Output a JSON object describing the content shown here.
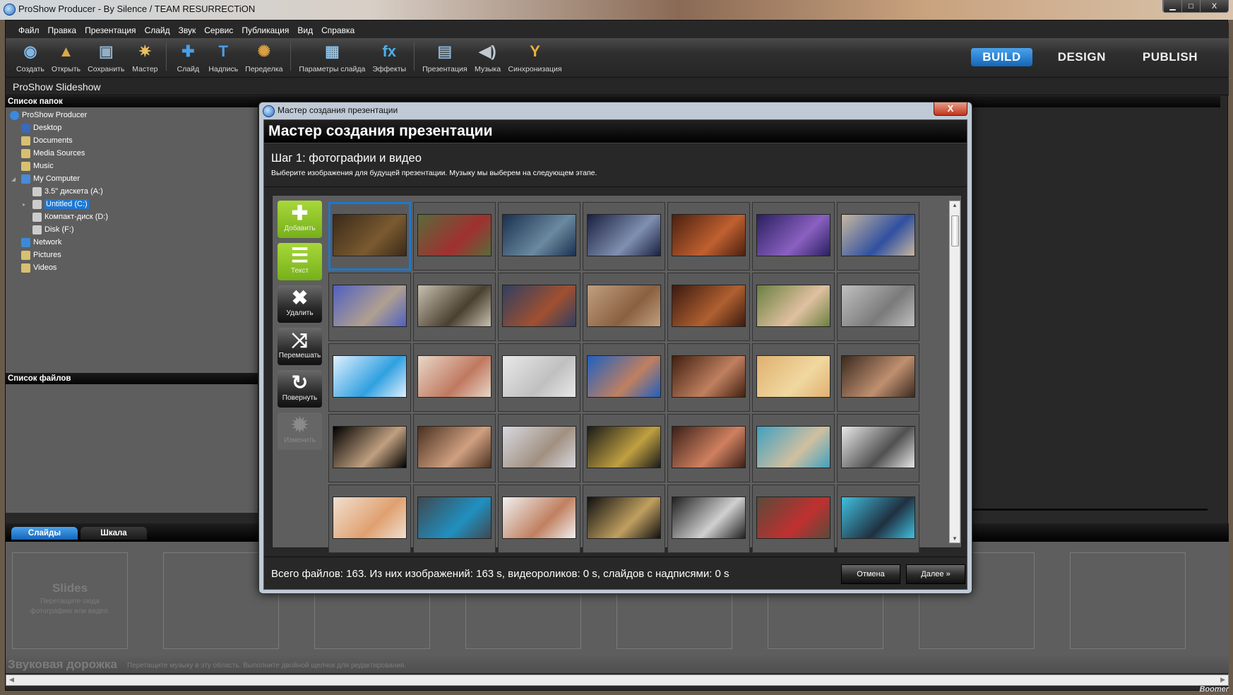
{
  "window": {
    "title": "ProShow Producer -  By Silence / TEAM RESURRECTiON",
    "controls": [
      "▁",
      "□",
      "X"
    ]
  },
  "menu": [
    "Файл",
    "Правка",
    "Презентация",
    "Слайд",
    "Звук",
    "Сервис",
    "Публикация",
    "Вид",
    "Справка"
  ],
  "toolbar": [
    {
      "label": "Создать",
      "icon": "film-reel-icon",
      "glyph": "◉",
      "color": "#7fb6e8"
    },
    {
      "label": "Открыть",
      "icon": "open-folder-icon",
      "glyph": "▲",
      "color": "#d8a84a"
    },
    {
      "label": "Сохранить",
      "icon": "floppy-disk-icon",
      "glyph": "▣",
      "color": "#8fb0c8"
    },
    {
      "label": "Мастер",
      "icon": "wizard-icon",
      "glyph": "✷",
      "color": "#e8c060"
    },
    {
      "sep": true
    },
    {
      "label": "Слайд",
      "icon": "add-slide-icon",
      "glyph": "✚",
      "color": "#4a9ee8"
    },
    {
      "label": "Надпись",
      "icon": "add-text-icon",
      "glyph": "T",
      "color": "#4a9ee8"
    },
    {
      "label": "Переделка",
      "icon": "remix-icon",
      "glyph": "✺",
      "color": "#d8a040"
    },
    {
      "sep": true
    },
    {
      "label": "Параметры слайда",
      "icon": "slide-options-icon",
      "glyph": "▦",
      "color": "#8ac0e8"
    },
    {
      "label": "Эффекты",
      "icon": "fx-icon",
      "glyph": "fx",
      "color": "#4ab0e8"
    },
    {
      "sep": true
    },
    {
      "label": "Презентация",
      "icon": "show-options-icon",
      "glyph": "▤",
      "color": "#8ab0d0"
    },
    {
      "label": "Музыка",
      "icon": "speaker-icon",
      "glyph": "◀)",
      "color": "#c0c8d0"
    },
    {
      "label": "Синхронизация",
      "icon": "sync-icon",
      "glyph": "Y",
      "color": "#e8b040"
    }
  ],
  "modes": {
    "build": "BUILD",
    "design": "DESIGN",
    "publish": "PUBLISH",
    "active": "build"
  },
  "show_name": "ProShow Slideshow",
  "folders": {
    "header": "Список папок",
    "items": [
      {
        "label": "ProShow Producer",
        "level": 0,
        "icon": "proshow-icon",
        "color": "#3a8ae0"
      },
      {
        "label": "Desktop",
        "level": 1,
        "icon": "desktop-icon",
        "color": "#3a6ab8"
      },
      {
        "label": "Documents",
        "level": 1,
        "icon": "folder-icon",
        "color": "#d8c070"
      },
      {
        "label": "Media Sources",
        "level": 1,
        "icon": "folder-icon",
        "color": "#d8c070"
      },
      {
        "label": "Music",
        "level": 1,
        "icon": "folder-icon",
        "color": "#d8c070"
      },
      {
        "label": "My Computer",
        "level": 1,
        "icon": "computer-icon",
        "color": "#4a8ad8",
        "expanded": true
      },
      {
        "label": "3.5\" дискета (A:)",
        "level": 2,
        "icon": "floppy-drive-icon",
        "color": "#ccc"
      },
      {
        "label": "Untitled (C:)",
        "level": 2,
        "icon": "hard-drive-icon",
        "color": "#ccc",
        "selected": true,
        "collapsed": true
      },
      {
        "label": "Компакт-диск (D:)",
        "level": 2,
        "icon": "cd-drive-icon",
        "color": "#ccc"
      },
      {
        "label": "Disk (F:)",
        "level": 2,
        "icon": "hard-drive-icon",
        "color": "#ccc"
      },
      {
        "label": "Network",
        "level": 1,
        "icon": "network-icon",
        "color": "#3a8ad8"
      },
      {
        "label": "Pictures",
        "level": 1,
        "icon": "folder-icon",
        "color": "#d8c070"
      },
      {
        "label": "Videos",
        "level": 1,
        "icon": "folder-icon",
        "color": "#d8c070"
      }
    ]
  },
  "files": {
    "header": "Список файлов"
  },
  "bottom_tabs": {
    "slides": "Слайды",
    "timeline": "Шкала",
    "active": "slides"
  },
  "slides_placeholder": {
    "title": "Slides",
    "hint": "Перетащите сюда фотографию или видео."
  },
  "audio_track": {
    "title": "Звуковая дорожка",
    "hint": "Перетащите музыку в эту область. Выполните двойной щелчок для редактирования."
  },
  "dialog": {
    "window_title": "Мастер создания презентации",
    "header": "Мастер создания презентации",
    "step_title": "Шаг 1: фотографии и видео",
    "step_desc": "Выберите изображения для будущей презентации. Музыку мы выберем на следующем этапе.",
    "side_buttons": [
      {
        "label": "Добавить",
        "icon": "plus-icon",
        "glyph": "✚",
        "style": "g"
      },
      {
        "label": "Текст",
        "icon": "add-text-list-icon",
        "glyph": "☰",
        "style": "g"
      },
      {
        "label": "Удалить",
        "icon": "x-icon",
        "glyph": "✖",
        "style": "d"
      },
      {
        "label": "Перемешать",
        "icon": "shuffle-icon",
        "glyph": "⤨",
        "style": "d"
      },
      {
        "label": "Повернуть",
        "icon": "rotate-icon",
        "glyph": "↻",
        "style": "d"
      },
      {
        "label": "Изменить",
        "icon": "gear-icon",
        "glyph": "✹",
        "style": "x",
        "disabled": true
      }
    ],
    "selected_index": 0,
    "thumbnails": [
      [
        "#3a2a1a",
        "#7a5a30"
      ],
      [
        "#5a6a3a",
        "#a03030"
      ],
      [
        "#1a3050",
        "#6a8aa0"
      ],
      [
        "#1a2040",
        "#8090b0"
      ],
      [
        "#4a2010",
        "#c06030"
      ],
      [
        "#2a2060",
        "#8a60c0"
      ],
      [
        "#c8b8a0",
        "#3050a0"
      ],
      [
        "#5060c0",
        "#b0a090"
      ],
      [
        "#c8c0b0",
        "#4a4030"
      ],
      [
        "#304060",
        "#a05030"
      ],
      [
        "#c0a080",
        "#8a6040"
      ],
      [
        "#3a1a10",
        "#b06030"
      ],
      [
        "#6a8040",
        "#e0c0a0"
      ],
      [
        "#c0c0c0",
        "#7a7a7a"
      ],
      [
        "#e0f0ff",
        "#30a0e0"
      ],
      [
        "#e8d8c8",
        "#c07860"
      ],
      [
        "#e8e8e8",
        "#c0c0c0"
      ],
      [
        "#2060c0",
        "#c08060"
      ],
      [
        "#402010",
        "#c08060"
      ],
      [
        "#e0b070",
        "#f0d8a0"
      ],
      [
        "#3a2a20",
        "#c09070"
      ],
      [
        "#000000",
        "#c0a080"
      ],
      [
        "#4a3020",
        "#d0a080"
      ],
      [
        "#d8d8e0",
        "#a09080"
      ],
      [
        "#1a1a1a",
        "#c0a040"
      ],
      [
        "#3a2018",
        "#d08060"
      ],
      [
        "#40a0c0",
        "#d0c0a0"
      ],
      [
        "#e8e8e8",
        "#505050"
      ],
      [
        "#f0e0d0",
        "#e0a070"
      ],
      [
        "#404850",
        "#2090c0"
      ],
      [
        "#f0f0f0",
        "#c08060"
      ],
      [
        "#101010",
        "#c0a060"
      ],
      [
        "#202020",
        "#d0d0d0"
      ],
      [
        "#5a4a3a",
        "#c03030"
      ],
      [
        "#40c0e0",
        "#203040"
      ]
    ],
    "status": "Всего файлов: 163. Из них изображений: 163 s, видеороликов: 0 s, слайдов с надписями: 0 s",
    "cancel": "Отмена",
    "next": "Далее »",
    "close": "X"
  },
  "watermark": "Boomer"
}
